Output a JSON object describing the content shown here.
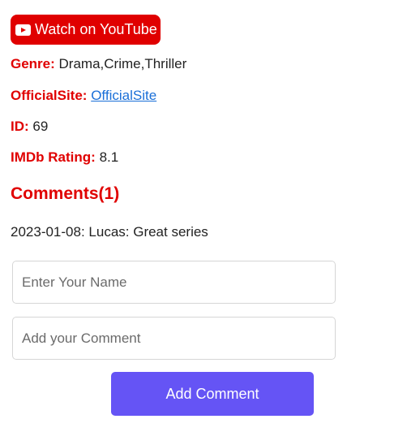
{
  "watch_button": {
    "label": "Watch on YouTube",
    "icon": "youtube-play-icon",
    "color": "#e00000"
  },
  "details": {
    "genre_label": "Genre:",
    "genre_value": "Drama,Crime,Thriller",
    "site_label": "OfficialSite:",
    "site_link_text": "OfficialSite",
    "id_label": "ID:",
    "id_value": "69",
    "rating_label": "IMDb Rating:",
    "rating_value": "8.1"
  },
  "comments": {
    "heading": "Comments(1)",
    "items": [
      {
        "text": "2023-01-08: Lucas: Great series"
      }
    ]
  },
  "form": {
    "name_placeholder": "Enter Your Name",
    "name_value": "",
    "comment_placeholder": "Add your Comment",
    "comment_value": "",
    "submit_label": "Add Comment",
    "submit_color": "#6554f5"
  },
  "colors": {
    "label_red": "#e00000",
    "link_blue": "#1a6fd8"
  }
}
